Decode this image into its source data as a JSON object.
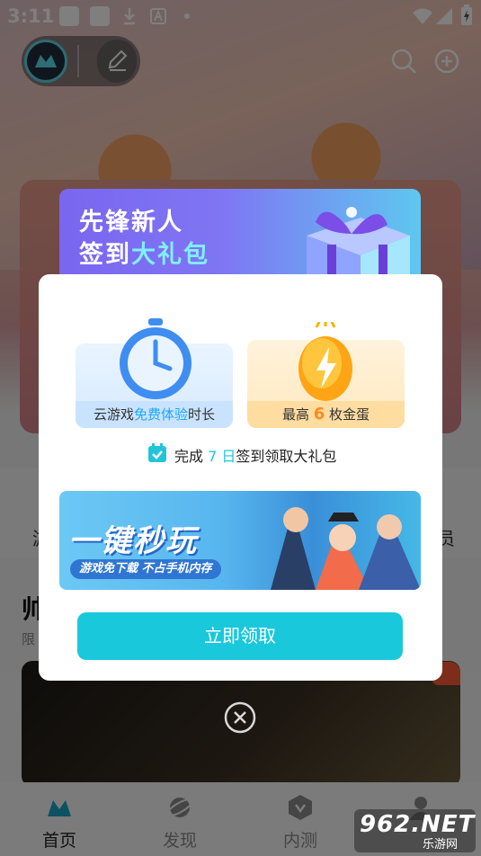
{
  "status_bar": {
    "time": "3:11"
  },
  "background": {
    "quick_links": [
      "游",
      "员"
    ],
    "section_title": "帅",
    "section_subtitle": "限"
  },
  "bottom_nav": [
    {
      "label": "首页",
      "icon": "home-gamepad-icon",
      "active": true
    },
    {
      "label": "发现",
      "icon": "planet-icon",
      "active": false
    },
    {
      "label": "内测",
      "icon": "shield-icon",
      "active": false
    },
    {
      "label": "",
      "icon": "profile-icon",
      "active": false
    }
  ],
  "modal": {
    "header_line1": "先锋新人",
    "header_line2_prefix": "签到",
    "header_line2_highlight": "大礼包",
    "card_time": {
      "prefix": "云游戏",
      "highlight": "免费体验",
      "suffix": "时长"
    },
    "card_egg": {
      "prefix": "最高 ",
      "number": "6",
      "suffix": " 枚金蛋"
    },
    "signin": {
      "prefix": "完成 ",
      "highlight": "7 日",
      "suffix": "签到领取大礼包"
    },
    "promo_title": "一键秒玩",
    "promo_subtitle": "游戏免下载  不占手机内存",
    "claim_button": "立即领取"
  },
  "watermark": {
    "text": "962.NET",
    "sub": "乐游网"
  },
  "colors": {
    "accent": "#1ac8db",
    "highlight_orange": "#ff8a1a",
    "highlight_blue": "#1aa8ff"
  }
}
